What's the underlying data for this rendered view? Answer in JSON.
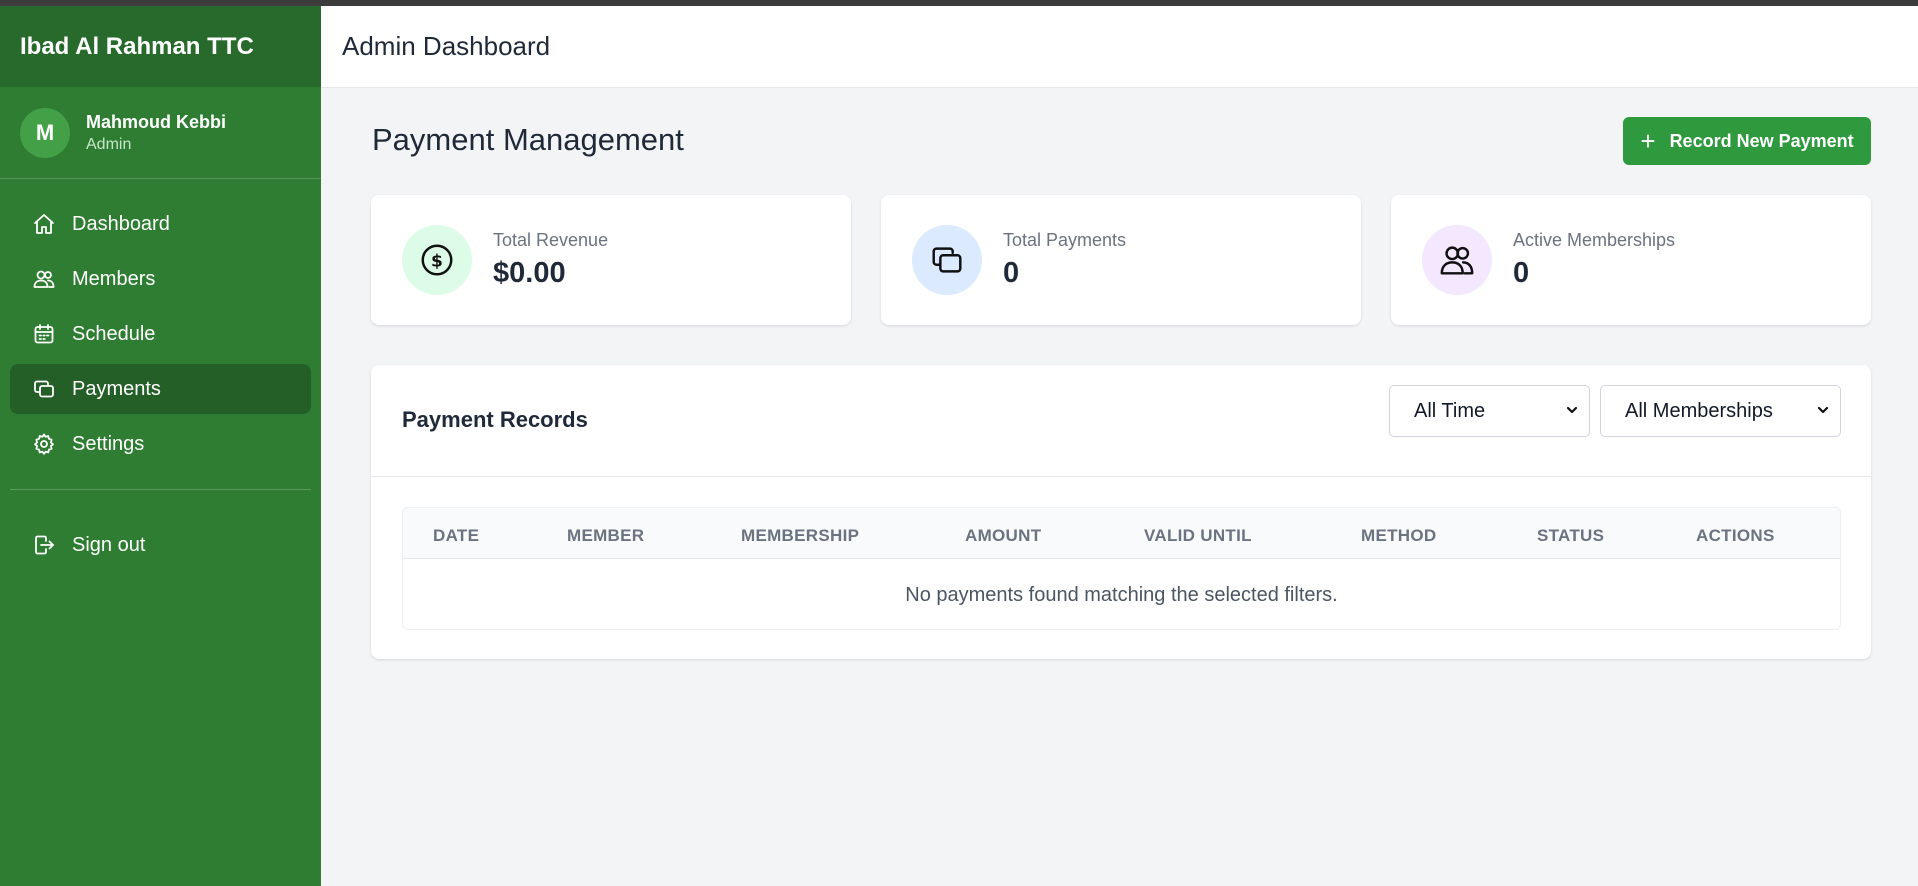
{
  "sidebar": {
    "brand": "Ibad Al Rahman TTC",
    "user": {
      "initial": "M",
      "name": "Mahmoud Kebbi",
      "role": "Admin"
    },
    "nav": [
      {
        "label": "Dashboard",
        "icon": "home-icon"
      },
      {
        "label": "Members",
        "icon": "users-icon"
      },
      {
        "label": "Schedule",
        "icon": "calendar-icon"
      },
      {
        "label": "Payments",
        "icon": "payments-icon",
        "active": true
      },
      {
        "label": "Settings",
        "icon": "gear-icon"
      }
    ],
    "signout": {
      "label": "Sign out",
      "icon": "sign-out-icon"
    },
    "colors": {
      "background": "#2e7d32",
      "brand_bar": "#276a2c",
      "active_item": "#245f28"
    }
  },
  "header": {
    "title": "Admin Dashboard"
  },
  "main": {
    "page_title": "Payment Management",
    "record_button": {
      "label": "Record New Payment",
      "icon": "plus-icon",
      "color": "#2e9a3d"
    },
    "stats": [
      {
        "label": "Total Revenue",
        "value": "$0.00",
        "icon": "dollar-icon",
        "icon_bg": "#dcfce7"
      },
      {
        "label": "Total Payments",
        "value": "0",
        "icon": "payments-icon",
        "icon_bg": "#dbeafe"
      },
      {
        "label": "Active Memberships",
        "value": "0",
        "icon": "users-icon",
        "icon_bg": "#f3e8ff"
      }
    ],
    "records": {
      "title": "Payment Records",
      "filters": {
        "time": {
          "selected": "All Time"
        },
        "membership": {
          "selected": "All Memberships"
        }
      },
      "columns": [
        "DATE",
        "MEMBER",
        "MEMBERSHIP",
        "AMOUNT",
        "VALID UNTIL",
        "METHOD",
        "STATUS",
        "ACTIONS"
      ],
      "empty_message": "No payments found matching the selected filters."
    }
  }
}
